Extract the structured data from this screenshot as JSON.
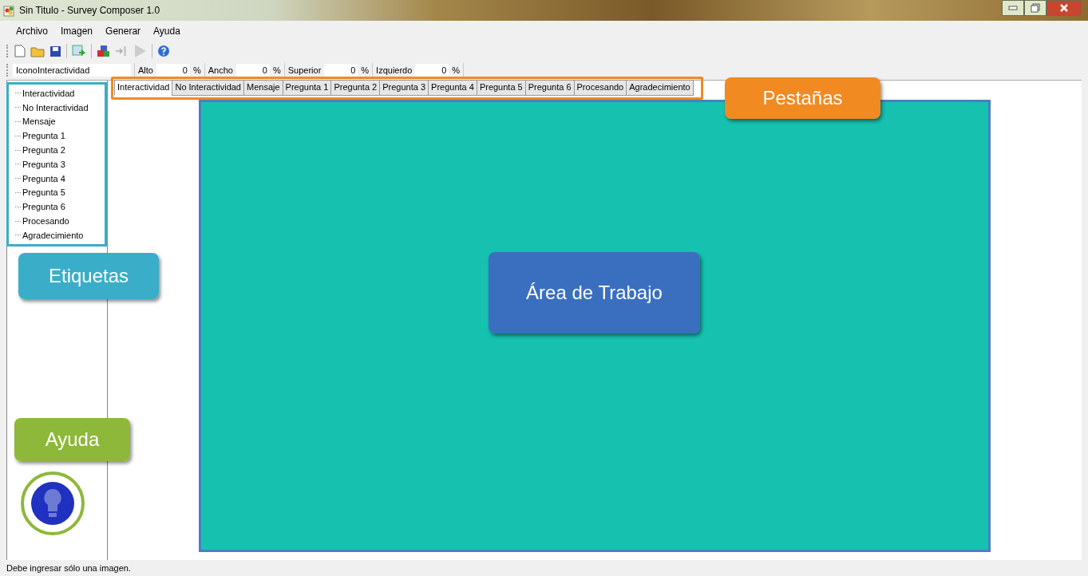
{
  "window": {
    "title": "Sin Titulo - Survey Composer 1.0"
  },
  "menu": [
    "Archivo",
    "Imagen",
    "Generar",
    "Ayuda"
  ],
  "properties": {
    "element": "IconoInteractividad",
    "measures": [
      {
        "label": "Alto",
        "value": "0",
        "unit": "%"
      },
      {
        "label": "Ancho",
        "value": "0",
        "unit": "%"
      },
      {
        "label": "Superior",
        "value": "0",
        "unit": "%"
      },
      {
        "label": "Izquierdo",
        "value": "0",
        "unit": "%"
      }
    ]
  },
  "tree": [
    "Interactividad",
    "No Interactividad",
    "Mensaje",
    "Pregunta 1",
    "Pregunta 2",
    "Pregunta 3",
    "Pregunta 4",
    "Pregunta 5",
    "Pregunta 6",
    "Procesando",
    "Agradecimiento"
  ],
  "tabs": [
    {
      "label": "Interactividad",
      "selected": true
    },
    {
      "label": "No Interactividad",
      "selected": false
    },
    {
      "label": "Mensaje",
      "selected": false
    },
    {
      "label": "Pregunta 1",
      "selected": false
    },
    {
      "label": "Pregunta 2",
      "selected": false
    },
    {
      "label": "Pregunta 3",
      "selected": false
    },
    {
      "label": "Pregunta 4",
      "selected": false
    },
    {
      "label": "Pregunta 5",
      "selected": false
    },
    {
      "label": "Pregunta 6",
      "selected": false
    },
    {
      "label": "Procesando",
      "selected": false
    },
    {
      "label": "Agradecimiento",
      "selected": false
    }
  ],
  "callouts": [
    {
      "label": "Pestañas",
      "color": "#f28a22"
    },
    {
      "label": "Etiquetas",
      "color": "#3aaec8"
    },
    {
      "label": "Ayuda",
      "color": "#8db83a"
    },
    {
      "label": "Área de Trabajo",
      "color": "#3a6fc0"
    }
  ],
  "status_bar": "Debe ingresar sólo una imagen."
}
